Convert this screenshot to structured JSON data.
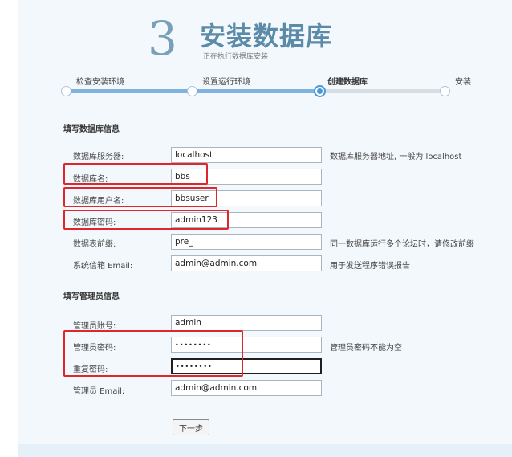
{
  "header": {
    "step_number": "3",
    "title": "安装数据库",
    "subtitle": "正在执行数据库安装"
  },
  "progress": {
    "steps": [
      "检查安装环境",
      "设置运行环境",
      "创建数据库",
      "安装"
    ],
    "current_index": 2
  },
  "db_section": {
    "title": "填写数据库信息",
    "fields": [
      {
        "label": "数据库服务器:",
        "value": "localhost",
        "hint": "数据库服务器地址, 一般为 localhost"
      },
      {
        "label": "数据库名:",
        "value": "bbs",
        "hint": ""
      },
      {
        "label": "数据库用户名:",
        "value": "bbsuser",
        "hint": ""
      },
      {
        "label": "数据库密码:",
        "value": "admin123",
        "hint": ""
      },
      {
        "label": "数据表前缀:",
        "value": "pre_",
        "hint": "同一数据库运行多个论坛时，请修改前缀"
      },
      {
        "label": "系统信箱 Email:",
        "value": "admin@admin.com",
        "hint": "用于发送程序错误报告"
      }
    ]
  },
  "admin_section": {
    "title": "填写管理员信息",
    "fields": [
      {
        "label": "管理员账号:",
        "value": "admin",
        "hint": ""
      },
      {
        "label": "管理员密码:",
        "value": "••••••••",
        "hint": "管理员密码不能为空"
      },
      {
        "label": "重复密码:",
        "value": "••••••••",
        "hint": ""
      },
      {
        "label": "管理员 Email:",
        "value": "admin@admin.com",
        "hint": ""
      }
    ]
  },
  "next_button_label": "下一步",
  "colors": {
    "accent": "#4a98d8",
    "title": "#5c8ba9",
    "highlight": "#e0262b",
    "panel_bg": "#f3f8fc"
  }
}
